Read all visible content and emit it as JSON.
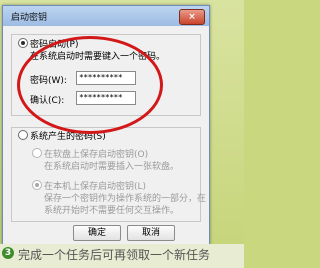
{
  "window": {
    "title": "启动密钥",
    "close_label": "×"
  },
  "password_startup": {
    "label": "密码启动(P)",
    "hint": "在系统启动时需要键入一个密码。",
    "password_label": "密码(W):",
    "password_value": "**********",
    "confirm_label": "确认(C):",
    "confirm_value": "**********"
  },
  "system_key": {
    "label": "系统产生的密码(S)",
    "floppy_label": "在软盘上保存启动密钥(O)",
    "floppy_hint": "在系统启动时需要插入一张软盘。",
    "local_label": "在本机上保存启动密钥(L)",
    "local_hint_line1": "保存一个密钥作为操作系统的一部分，在",
    "local_hint_line2": "系统开始时不需要任何交互操作。"
  },
  "buttons": {
    "ok": "确定",
    "cancel": "取消"
  },
  "footer": {
    "step": "3",
    "text": "完成一个任务后可再领取一个新任务"
  },
  "colors": {
    "highlight_ellipse": "#d21818",
    "titlebar": "#9ebbe3"
  }
}
